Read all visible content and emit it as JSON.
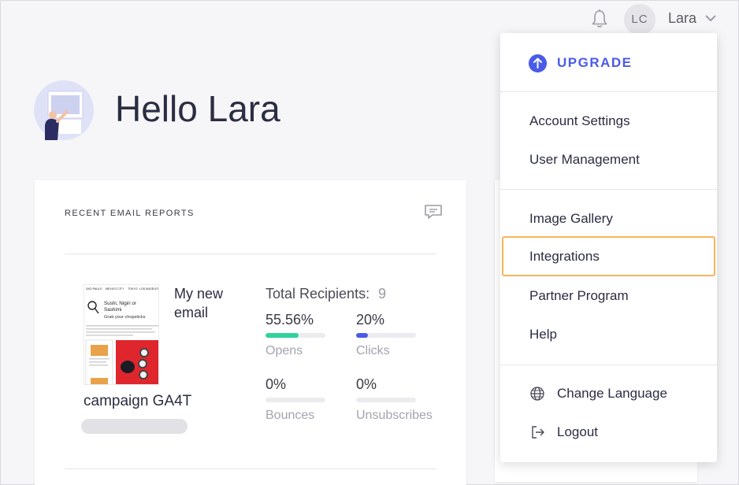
{
  "header": {
    "avatar_initials": "LC",
    "user_name": "Lara",
    "icons": {
      "notifications": "bell-icon",
      "user_menu": "chevron-down-icon"
    }
  },
  "greeting": {
    "text": "Hello Lara",
    "illustration": "person-at-board-illustration"
  },
  "recent_reports": {
    "title": "RECENT EMAIL REPORTS",
    "feedback_icon": "chat-bubble-icon",
    "report": {
      "email_name": "My new email",
      "campaign": "campaign GA4T",
      "total_recipients_label": "Total Recipients:",
      "total_recipients_value": "9",
      "stats": [
        {
          "label": "Opens",
          "value": "55.56%",
          "fraction": 0.5556,
          "color": "#2fd39a"
        },
        {
          "label": "Clicks",
          "value": "20%",
          "fraction": 0.2,
          "color": "#4a5be8"
        },
        {
          "label": "Bounces",
          "value": "0%",
          "fraction": 0,
          "color": "#e24b4b"
        },
        {
          "label": "Unsubscribes",
          "value": "0%",
          "fraction": 0,
          "color": "#f7b55c"
        }
      ],
      "thumbnail": {
        "nav": [
          "SAO PAULO",
          "MEXICO CITY",
          "TOKYO",
          "LOS ANGELES"
        ],
        "headline": "Sushi, Nigiri or Sashimi",
        "subline": "Grab your chopsticks"
      }
    }
  },
  "user_menu": {
    "upgrade_label": "UPGRADE",
    "items": [
      {
        "label": "Account Settings"
      },
      {
        "label": "User Management"
      },
      {
        "label": "Image Gallery"
      },
      {
        "label": "Integrations",
        "highlighted": true
      },
      {
        "label": "Partner Program"
      },
      {
        "label": "Help"
      },
      {
        "label": "Change Language",
        "icon": "globe-icon"
      },
      {
        "label": "Logout",
        "icon": "logout-icon"
      }
    ]
  },
  "colors": {
    "accent": "#4a5be8",
    "highlight_border": "#f7b55c",
    "opens": "#2fd39a",
    "clicks": "#4a5be8"
  }
}
